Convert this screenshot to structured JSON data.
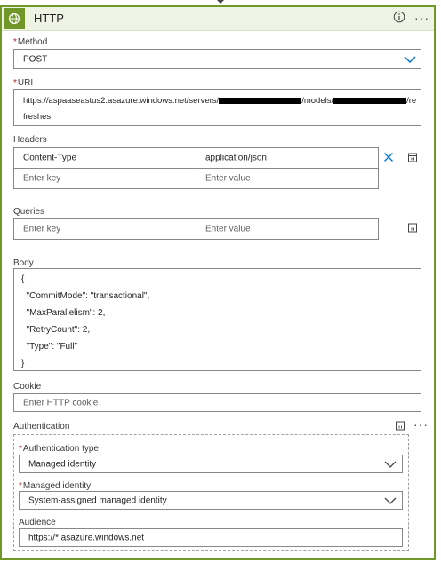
{
  "header": {
    "title": "HTTP",
    "icons": [
      "globe-icon",
      "info-icon",
      "more-icon"
    ],
    "accent_color": "#709727",
    "header_bg": "#eef3e4"
  },
  "method": {
    "label": "Method",
    "value": "POST"
  },
  "uri": {
    "label": "URI",
    "line1_a": "https://aspaaseastus2.asazure.windows.net/servers/",
    "line1_b": "/models/",
    "line1_c": "/re",
    "line2": "freshes"
  },
  "headers": {
    "label": "Headers",
    "rows": [
      {
        "key": "Content-Type",
        "value": "application/json"
      }
    ],
    "key_placeholder": "Enter key",
    "value_placeholder": "Enter value"
  },
  "queries": {
    "label": "Queries",
    "key_placeholder": "Enter key",
    "value_placeholder": "Enter value"
  },
  "body": {
    "label": "Body",
    "lines": [
      "{",
      "  \"CommitMode\": \"transactional\",",
      "  \"MaxParallelism\": 2,",
      "  \"RetryCount\": 2,",
      "  \"Type\": \"Full\"",
      "}"
    ]
  },
  "cookie": {
    "label": "Cookie",
    "placeholder": "Enter HTTP cookie"
  },
  "authentication": {
    "label": "Authentication",
    "type_label": "Authentication type",
    "type_value": "Managed identity",
    "identity_label": "Managed identity",
    "identity_value": "System-assigned managed identity",
    "audience_label": "Audience",
    "audience_value": "https://*.asazure.windows.net"
  },
  "colors": {
    "required": "#a4262c",
    "chevron": "#0078d4",
    "border": "#8a8886"
  }
}
